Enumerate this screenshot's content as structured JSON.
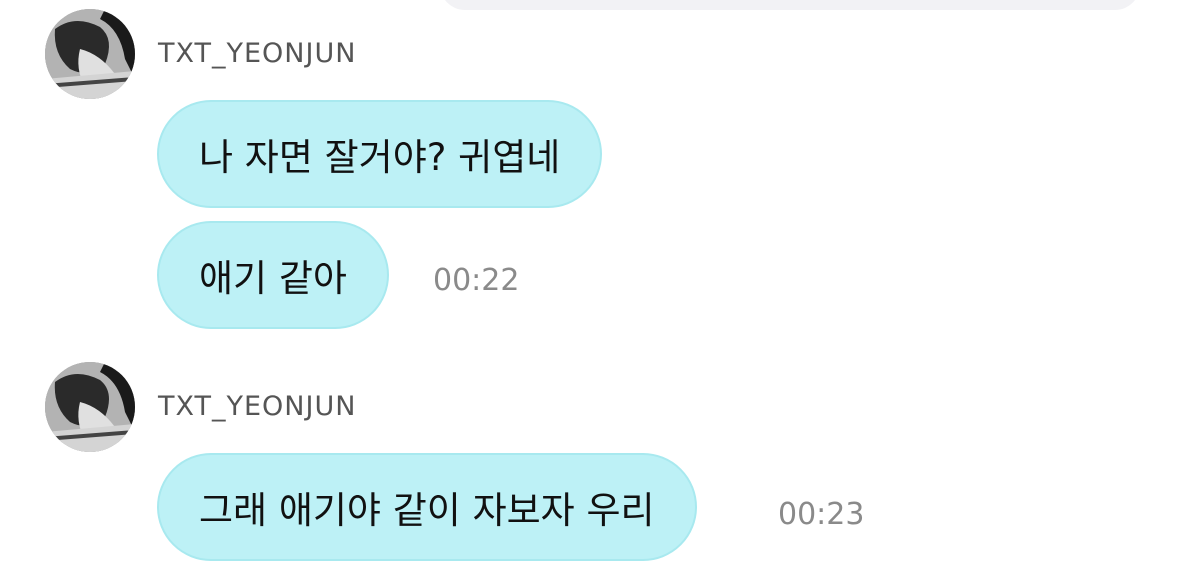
{
  "colors": {
    "bubble_bg": "#bdf1f6",
    "bubble_border": "#a8e9ef",
    "username": "#555555",
    "timestamp": "#8a8a8a",
    "previous_bubble": "#f2f2f5"
  },
  "messages_group_1": {
    "avatar_icon": "profile-photo-icon",
    "username": "TXT_YEONJUN",
    "messages": [
      {
        "text": "나 자면 잘거야? 귀엽네",
        "time": ""
      },
      {
        "text": "애기 같아",
        "time": "00:22"
      }
    ]
  },
  "messages_group_2": {
    "avatar_icon": "profile-photo-icon",
    "username": "TXT_YEONJUN",
    "messages": [
      {
        "text": "그래 애기야 같이 자보자 우리",
        "time": "00:23"
      }
    ]
  }
}
